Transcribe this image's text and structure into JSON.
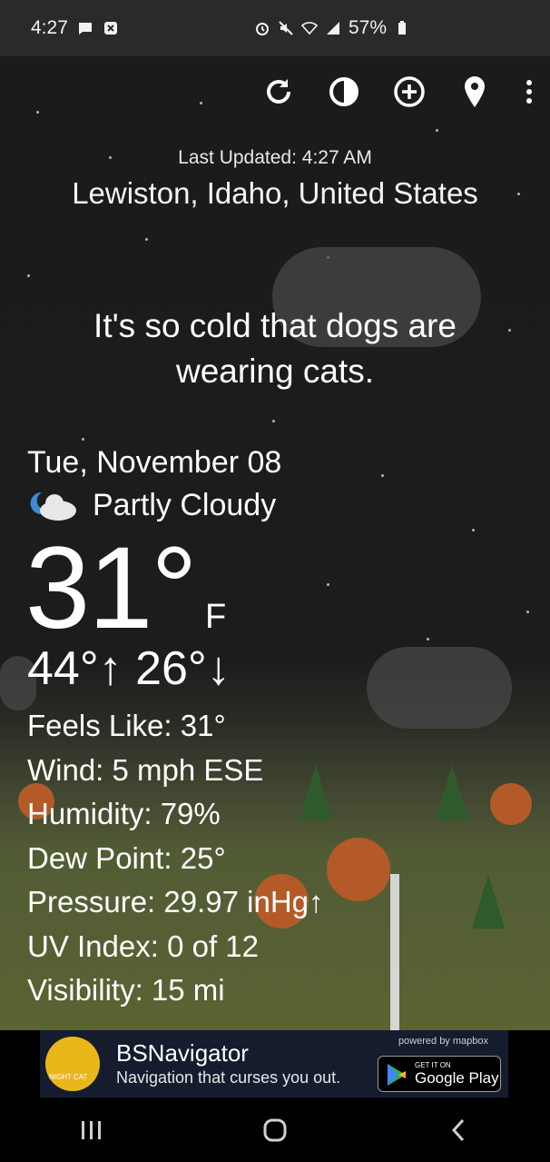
{
  "status_bar": {
    "time": "4:27",
    "battery": "57%"
  },
  "header": {
    "last_updated": "Last Updated: 4:27 AM",
    "location": "Lewiston, Idaho, United States"
  },
  "quote": "It's so cold that dogs are wearing cats.",
  "current": {
    "date": "Tue, November 08",
    "condition": "Partly Cloudy",
    "temperature": "31°",
    "unit": "F",
    "hilo": "44°↑ 26°↓"
  },
  "details": {
    "feels_like": "Feels Like:  31°",
    "wind": "Wind:  5 mph ESE",
    "humidity": "Humidity:  79%",
    "dew_point": "Dew Point:  25°",
    "pressure": "Pressure:  29.97 inHg↑",
    "uv_index": "UV Index:  0 of 12",
    "visibility": "Visibility:  15 mi"
  },
  "ad": {
    "title": "BSNavigator",
    "subtitle": "Navigation that curses you out.",
    "powered_by": "powered by mapbox",
    "play_small": "GET IT ON",
    "play_big": "Google Play",
    "logo_text": "NIGHT CAT"
  },
  "icons": {
    "refresh": "refresh-icon",
    "theme": "theme-icon",
    "add": "add-location-icon",
    "pin": "location-pin-icon",
    "more": "more-vert-icon"
  }
}
